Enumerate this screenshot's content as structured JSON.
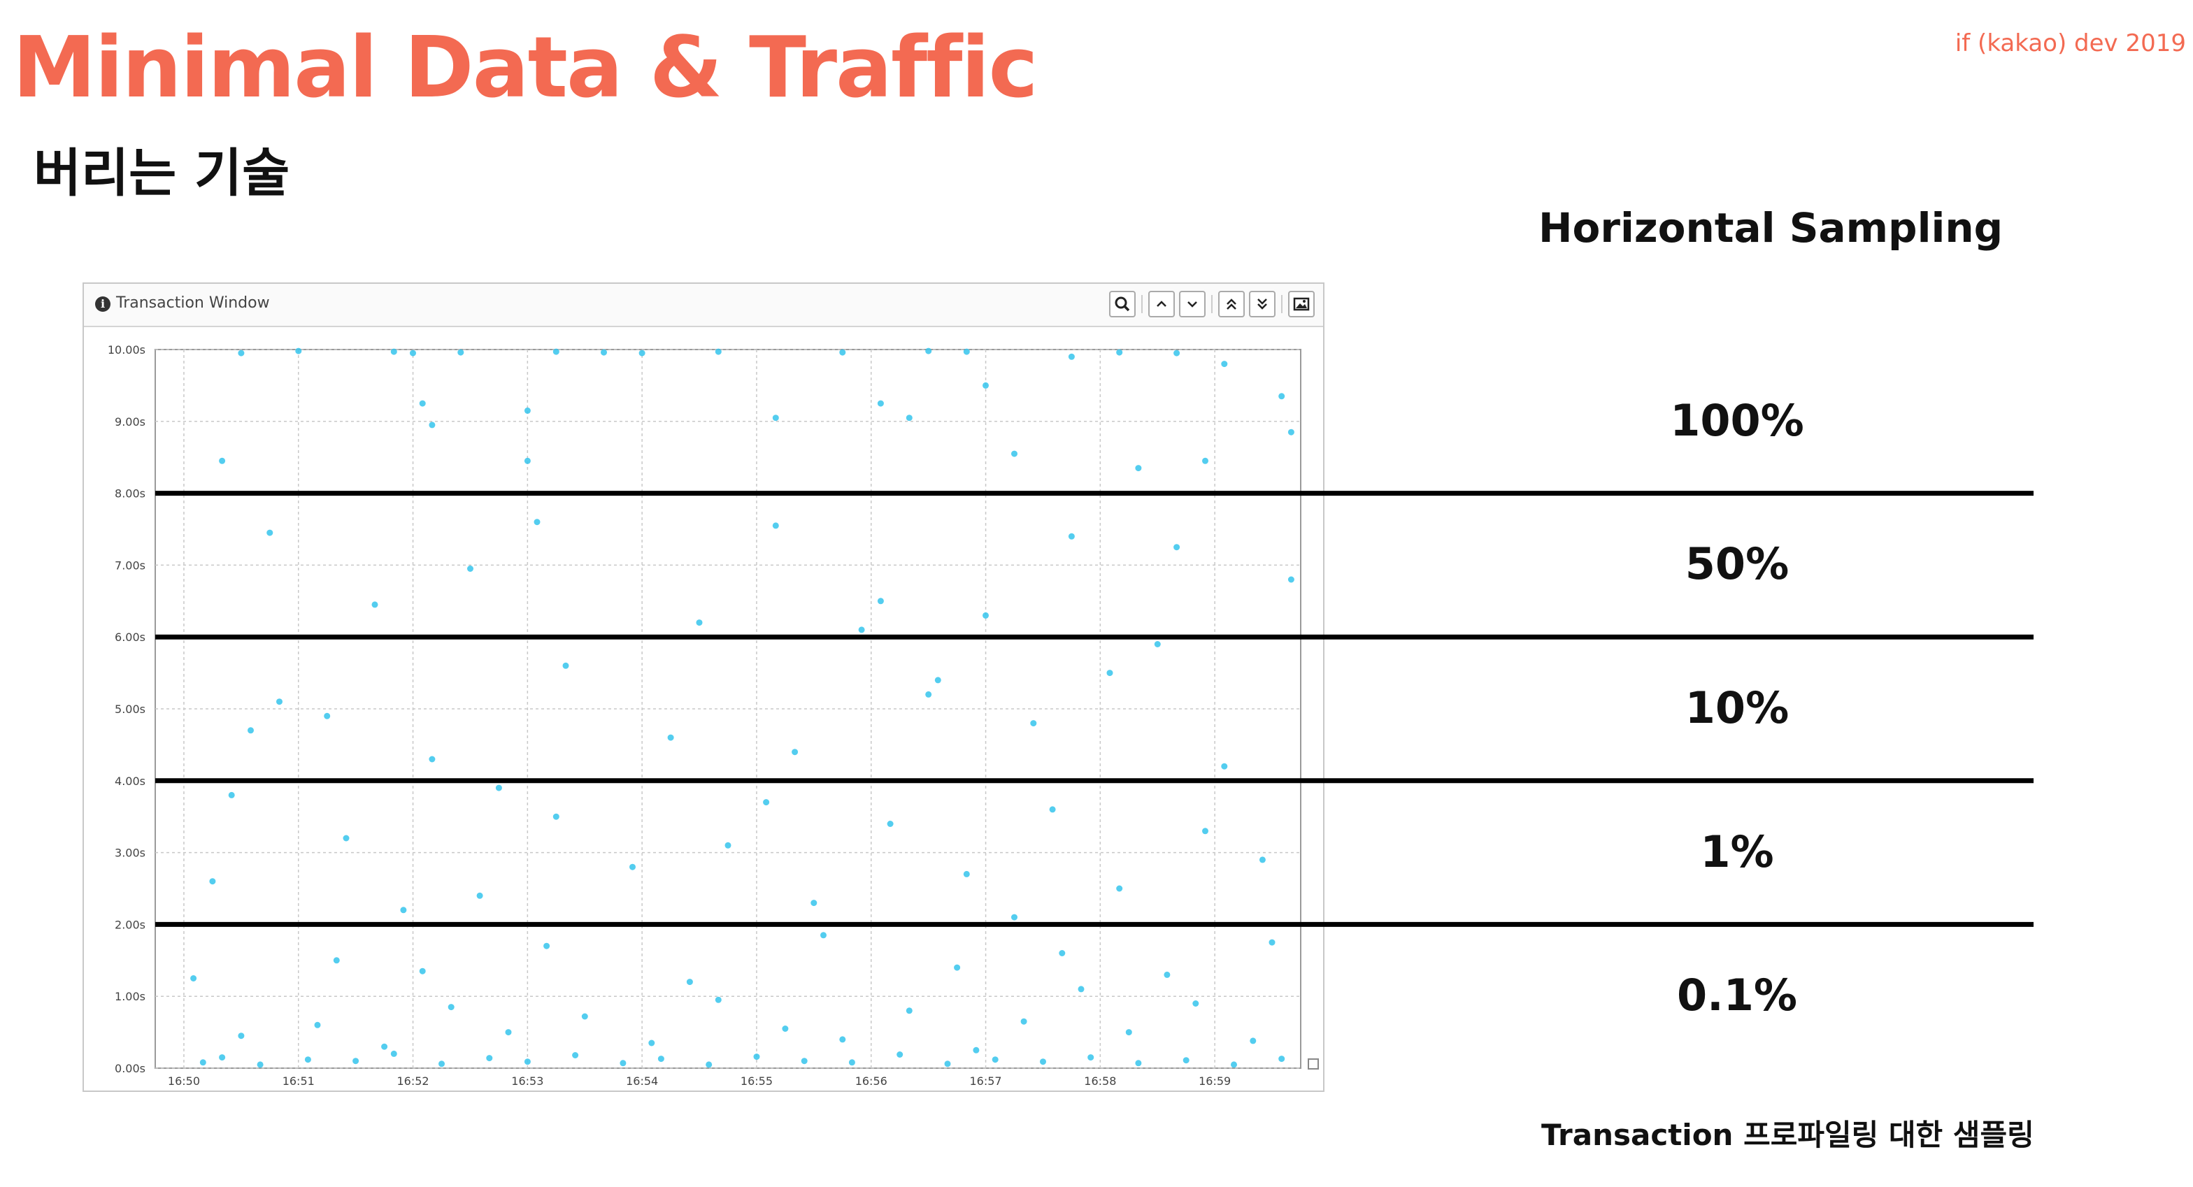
{
  "slide": {
    "title": "Minimal Data & Traffic",
    "conference": "if (kakao) dev 2019",
    "subtitle": "버리는 기술",
    "panel_heading": "Horizontal Sampling",
    "caption": "Transaction 프로파일링 대한 샘플링"
  },
  "window": {
    "title": "Transaction Window",
    "toolbar": [
      "search-icon",
      "chevron-up-icon",
      "chevron-down-icon",
      "double-chevron-up-icon",
      "double-chevron-down-icon",
      "image-icon"
    ]
  },
  "sampling_bands": [
    {
      "range": [
        8,
        10
      ],
      "rate": "100%"
    },
    {
      "range": [
        6,
        8
      ],
      "rate": "50%"
    },
    {
      "range": [
        4,
        6
      ],
      "rate": "10%"
    },
    {
      "range": [
        2,
        4
      ],
      "rate": "1%"
    },
    {
      "range": [
        0,
        2
      ],
      "rate": "0.1%"
    }
  ],
  "colors": {
    "accent": "#f36a52",
    "point": "#35c4ec",
    "band_line": "#000000",
    "grid": "#c8c8c8"
  },
  "chart_data": {
    "type": "scatter",
    "xlim": [
      "16:49:45",
      "16:59:45"
    ],
    "ylim": [
      0,
      10
    ],
    "x_ticks": [
      "16:50",
      "16:51",
      "16:52",
      "16:53",
      "16:54",
      "16:55",
      "16:56",
      "16:57",
      "16:58",
      "16:59"
    ],
    "y_ticks": [
      "0.00s",
      "1.00s",
      "2.00s",
      "3.00s",
      "4.00s",
      "5.00s",
      "6.00s",
      "7.00s",
      "8.00s",
      "9.00s",
      "10.00s"
    ],
    "grid": true,
    "band_lines": [
      8,
      6,
      4,
      2
    ],
    "series": [
      {
        "values": [
          [
            "16:50:10",
            0.08
          ],
          [
            "16:50:20",
            0.15
          ],
          [
            "16:50:40",
            0.05
          ],
          [
            "16:51:05",
            0.12
          ],
          [
            "16:51:30",
            0.1
          ],
          [
            "16:51:50",
            0.2
          ],
          [
            "16:52:15",
            0.06
          ],
          [
            "16:52:40",
            0.14
          ],
          [
            "16:53:00",
            0.09
          ],
          [
            "16:53:25",
            0.18
          ],
          [
            "16:53:50",
            0.07
          ],
          [
            "16:54:10",
            0.13
          ],
          [
            "16:54:35",
            0.05
          ],
          [
            "16:55:00",
            0.16
          ],
          [
            "16:55:25",
            0.1
          ],
          [
            "16:55:50",
            0.08
          ],
          [
            "16:56:15",
            0.19
          ],
          [
            "16:56:40",
            0.06
          ],
          [
            "16:57:05",
            0.12
          ],
          [
            "16:57:30",
            0.09
          ],
          [
            "16:57:55",
            0.15
          ],
          [
            "16:58:20",
            0.07
          ],
          [
            "16:58:45",
            0.11
          ],
          [
            "16:59:10",
            0.05
          ],
          [
            "16:59:35",
            0.13
          ],
          [
            "16:50:30",
            0.45
          ],
          [
            "16:51:10",
            0.6
          ],
          [
            "16:51:45",
            0.3
          ],
          [
            "16:52:20",
            0.85
          ],
          [
            "16:52:50",
            0.5
          ],
          [
            "16:53:30",
            0.72
          ],
          [
            "16:54:05",
            0.35
          ],
          [
            "16:54:40",
            0.95
          ],
          [
            "16:55:15",
            0.55
          ],
          [
            "16:55:45",
            0.4
          ],
          [
            "16:56:20",
            0.8
          ],
          [
            "16:56:55",
            0.25
          ],
          [
            "16:57:20",
            0.65
          ],
          [
            "16:57:50",
            1.1
          ],
          [
            "16:58:15",
            0.5
          ],
          [
            "16:58:50",
            0.9
          ],
          [
            "16:59:20",
            0.38
          ],
          [
            "16:50:05",
            1.25
          ],
          [
            "16:51:20",
            1.5
          ],
          [
            "16:52:05",
            1.35
          ],
          [
            "16:53:10",
            1.7
          ],
          [
            "16:54:25",
            1.2
          ],
          [
            "16:55:35",
            1.85
          ],
          [
            "16:56:45",
            1.4
          ],
          [
            "16:57:40",
            1.6
          ],
          [
            "16:58:35",
            1.3
          ],
          [
            "16:59:30",
            1.75
          ],
          [
            "16:50:15",
            2.6
          ],
          [
            "16:51:25",
            3.2
          ],
          [
            "16:52:35",
            2.4
          ],
          [
            "16:53:15",
            3.5
          ],
          [
            "16:53:55",
            2.8
          ],
          [
            "16:54:45",
            3.1
          ],
          [
            "16:55:30",
            2.3
          ],
          [
            "16:56:10",
            3.4
          ],
          [
            "16:56:50",
            2.7
          ],
          [
            "16:57:35",
            3.6
          ],
          [
            "16:58:10",
            2.5
          ],
          [
            "16:58:55",
            3.3
          ],
          [
            "16:59:25",
            2.9
          ],
          [
            "16:50:25",
            3.8
          ],
          [
            "16:51:55",
            2.2
          ],
          [
            "16:52:45",
            3.9
          ],
          [
            "16:55:05",
            3.7
          ],
          [
            "16:57:15",
            2.1
          ],
          [
            "16:50:35",
            4.7
          ],
          [
            "16:51:15",
            4.9
          ],
          [
            "16:52:10",
            4.3
          ],
          [
            "16:53:20",
            5.6
          ],
          [
            "16:54:15",
            4.6
          ],
          [
            "16:55:20",
            4.4
          ],
          [
            "16:56:30",
            5.2
          ],
          [
            "16:57:25",
            4.8
          ],
          [
            "16:58:05",
            5.5
          ],
          [
            "16:59:05",
            4.2
          ],
          [
            "16:50:50",
            5.1
          ],
          [
            "16:56:35",
            5.4
          ],
          [
            "16:58:30",
            5.9
          ],
          [
            "16:51:40",
            6.45
          ],
          [
            "16:52:30",
            6.95
          ],
          [
            "16:53:05",
            7.6
          ],
          [
            "16:54:30",
            6.2
          ],
          [
            "16:55:10",
            7.55
          ],
          [
            "16:56:05",
            6.5
          ],
          [
            "16:57:00",
            6.3
          ],
          [
            "16:57:45",
            7.4
          ],
          [
            "16:58:40",
            7.25
          ],
          [
            "16:59:40",
            6.8
          ],
          [
            "16:50:45",
            7.45
          ],
          [
            "16:55:55",
            6.1
          ],
          [
            "16:50:20",
            8.45
          ],
          [
            "16:50:30",
            9.95
          ],
          [
            "16:51:00",
            9.98
          ],
          [
            "16:51:50",
            9.97
          ],
          [
            "16:52:00",
            9.95
          ],
          [
            "16:52:05",
            9.25
          ],
          [
            "16:52:10",
            8.95
          ],
          [
            "16:52:25",
            9.96
          ],
          [
            "16:53:00",
            9.15
          ],
          [
            "16:53:00",
            8.45
          ],
          [
            "16:53:15",
            9.97
          ],
          [
            "16:53:40",
            9.96
          ],
          [
            "16:54:00",
            9.95
          ],
          [
            "16:54:40",
            9.97
          ],
          [
            "16:55:10",
            9.05
          ],
          [
            "16:55:45",
            9.96
          ],
          [
            "16:56:05",
            9.25
          ],
          [
            "16:56:20",
            9.05
          ],
          [
            "16:56:30",
            9.98
          ],
          [
            "16:56:50",
            9.97
          ],
          [
            "16:57:00",
            9.5
          ],
          [
            "16:57:15",
            8.55
          ],
          [
            "16:57:45",
            9.9
          ],
          [
            "16:58:10",
            9.96
          ],
          [
            "16:58:20",
            8.35
          ],
          [
            "16:58:40",
            9.95
          ],
          [
            "16:58:55",
            8.45
          ],
          [
            "16:59:05",
            9.8
          ],
          [
            "16:59:35",
            9.35
          ],
          [
            "16:59:40",
            8.85
          ]
        ]
      }
    ]
  }
}
